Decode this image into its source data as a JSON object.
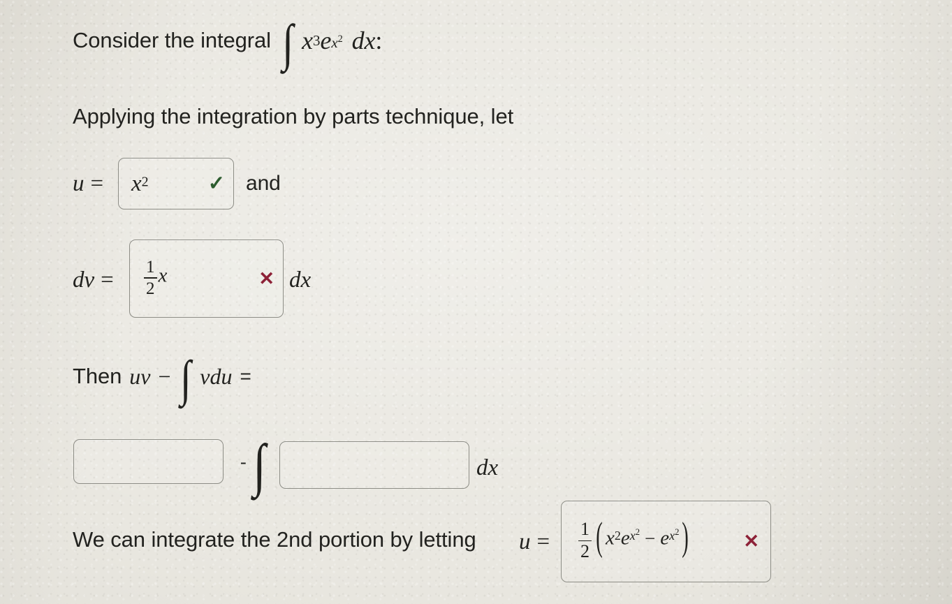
{
  "page": {
    "background_color": "#e9e7e0",
    "text_color": "#22221f",
    "box_border_color": "#8d8d86",
    "correct_mark_color": "#2c5c2e",
    "incorrect_mark_color": "#8d2137"
  },
  "problem": {
    "prompt_prefix": "Consider the integral",
    "integrand_base": "x",
    "integrand_exp": "3",
    "integrand_e": "e",
    "integrand_e_exp_base": "x",
    "integrand_e_exp_exp": "2",
    "differential": "dx",
    "prompt_colon": ":",
    "instruction": "Applying the integration by parts technique, let"
  },
  "substitutions": {
    "u": {
      "label": "u",
      "equals": "=",
      "value_base": "x",
      "value_exp": "2",
      "mark": "✓",
      "mark_state": "correct",
      "trailing_word": "and"
    },
    "dv": {
      "label": "dv",
      "equals": "=",
      "value_numerator": "1",
      "value_denominator": "2",
      "value_variable": "x",
      "mark": "✕",
      "mark_state": "incorrect",
      "trailing_differential": "dx"
    }
  },
  "parts_formula": {
    "lead_text": "Then",
    "uv": "uv",
    "minus": "−",
    "integral": "∫",
    "vdu": "vdu",
    "equals": "="
  },
  "answer_row": {
    "blank1_value": "",
    "blank1_placeholder": "",
    "minus": "-",
    "integral": "∫",
    "blank2_value": "",
    "blank2_placeholder": "",
    "differential": "dx"
  },
  "second_portion": {
    "text": "We can integrate the 2nd portion by letting",
    "u_label": "u",
    "equals": "=",
    "answer": {
      "fraction_numerator": "1",
      "fraction_denominator": "2",
      "open_paren": "(",
      "term1_base": "x",
      "term1_exp": "2",
      "term1_e": "e",
      "term1_e_exp_base": "x",
      "term1_e_exp_exp": "2",
      "operator": "−",
      "term2_e": "e",
      "term2_e_exp_base": "x",
      "term2_e_exp_exp": "2",
      "close_paren": ")",
      "mark": "✕",
      "mark_state": "incorrect"
    }
  }
}
